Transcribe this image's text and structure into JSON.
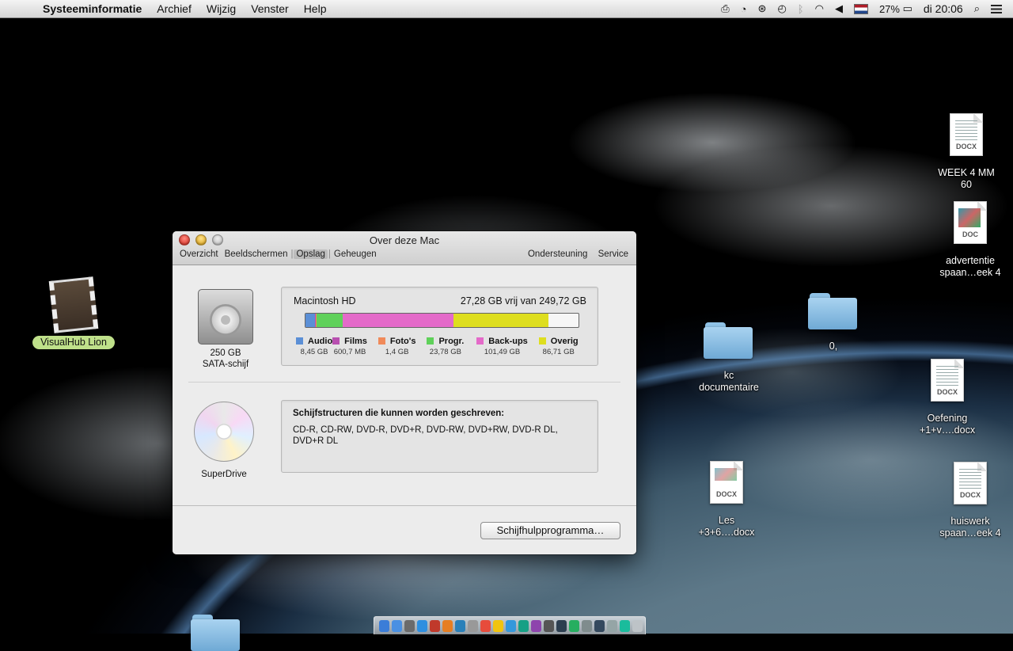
{
  "menubar": {
    "app_name": "Systeeminformatie",
    "menus": [
      "Archief",
      "Wijzig",
      "Venster",
      "Help"
    ],
    "battery": "27%",
    "clock": "di 20:06"
  },
  "desktop_icons": {
    "visualhub": "VisualHub Lion",
    "week4": [
      "WEEK 4 MM",
      "60"
    ],
    "week4_ext": "DOCX",
    "advertentie": [
      "advertentie",
      "spaan…eek 4"
    ],
    "advertentie_ext": "DOC",
    "folder_zero": "0,",
    "folder_kc": [
      "kc",
      "documentaire"
    ],
    "oefening": [
      "Oefening",
      "+1+v….docx"
    ],
    "oefening_ext": "DOCX",
    "les": [
      "Les",
      "+3+6….docx"
    ],
    "les_ext": "DOCX",
    "huiswerk": [
      "huiswerk",
      "spaan…eek 4"
    ],
    "huiswerk_ext": "DOCX"
  },
  "window": {
    "title": "Over deze Mac",
    "tabs": [
      "Overzicht",
      "Beeldschermen",
      "Opslag",
      "Geheugen"
    ],
    "active_tab": "Opslag",
    "tabs_right": [
      "Ondersteuning",
      "Service"
    ],
    "hdd": {
      "size": "250 GB",
      "type": "SATA-schijf"
    },
    "storage": {
      "disk_name": "Macintosh HD",
      "free_text": "27,28 GB vrij van 249,72 GB",
      "categories": [
        {
          "label": "Audio",
          "size": "8,45 GB",
          "gb": 8.45,
          "color": "#5b8fd6"
        },
        {
          "label": "Films",
          "size": "600,7 MB",
          "gb": 0.6,
          "color": "#b84fb0"
        },
        {
          "label": "Foto's",
          "size": "1,4 GB",
          "gb": 1.4,
          "color": "#f08a5a"
        },
        {
          "label": "Progr.",
          "size": "23,78 GB",
          "gb": 23.78,
          "color": "#5fd15a"
        },
        {
          "label": "Back-ups",
          "size": "101,49 GB",
          "gb": 101.49,
          "color": "#e46ac9"
        },
        {
          "label": "Overig",
          "size": "86,71 GB",
          "gb": 86.71,
          "color": "#dede1f"
        }
      ],
      "total_gb": 249.72
    },
    "superdrive": {
      "label": "SuperDrive",
      "write_title": "Schijfstructuren die kunnen worden geschreven:",
      "write_formats": "CD-R, CD-RW, DVD-R, DVD+R, DVD-RW, DVD+RW, DVD-R DL, DVD+R DL"
    },
    "button_label": "Schijfhulpprogramma…"
  }
}
